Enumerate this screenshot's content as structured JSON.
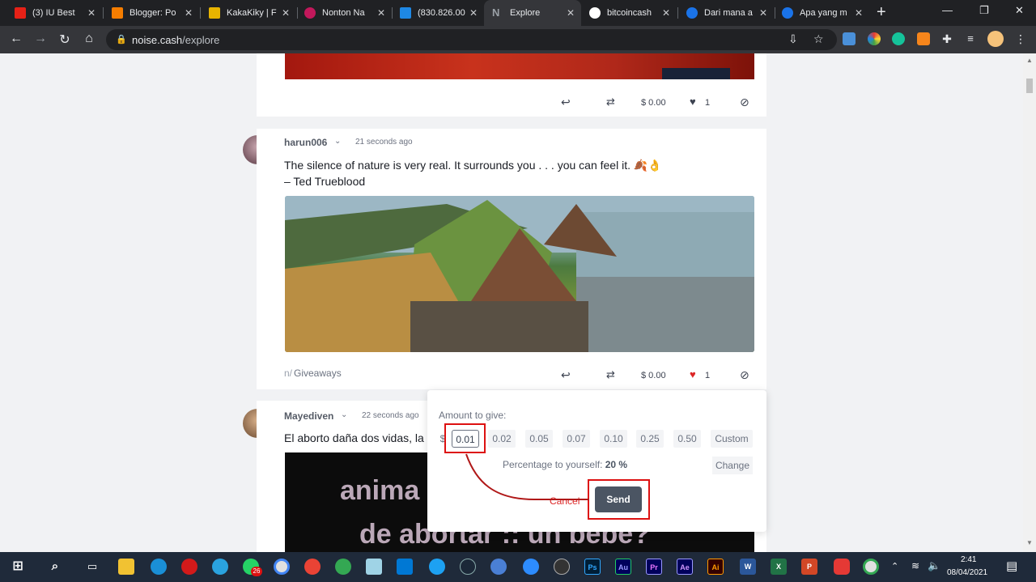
{
  "browser": {
    "tabs": [
      {
        "title": "(3) IU Best",
        "favicon_color": "#e62117"
      },
      {
        "title": "Blogger: Po",
        "favicon_color": "#f57d00"
      },
      {
        "title": "KakaKiky | F",
        "favicon_color": "#e8b400"
      },
      {
        "title": "Nonton Na",
        "favicon_color": "#c2185b"
      },
      {
        "title": "(830.826.00",
        "favicon_color": "#1e88e5"
      },
      {
        "title": "Explore",
        "favicon_color": "#9aa0a6"
      },
      {
        "title": "bitcoincash",
        "favicon_color": "#ffffff"
      },
      {
        "title": "Dari mana a",
        "favicon_color": "#1a73e8"
      },
      {
        "title": "Apa yang m",
        "favicon_color": "#1a73e8"
      }
    ],
    "url_host": "noise.cash",
    "url_path": "/explore"
  },
  "posts": [
    {
      "actions": {
        "tip": "$ 0.00",
        "likes": "1"
      }
    },
    {
      "username": "harun006",
      "time": "21 seconds ago",
      "text_line1": "The silence of nature is very real. It surrounds you . . . you can feel it. 🍂👌",
      "text_line2": "– Ted Trueblood",
      "community_prefix": "n/",
      "community": "Giveaways",
      "actions": {
        "tip": "$ 0.00",
        "likes": "1"
      }
    },
    {
      "username": "Mayediven",
      "time": "22 seconds ago",
      "text": "El aborto daña dos vidas, la",
      "image_text_line1": "anima",
      "image_text_line2": "de abortar :: un bebe?"
    }
  ],
  "tip_popup": {
    "label": "Amount to give:",
    "currency": "$",
    "amounts": [
      "0.01",
      "0.02",
      "0.05",
      "0.07",
      "0.10",
      "0.25",
      "0.50",
      "Custom"
    ],
    "selected": "0.01",
    "percentage_label": "Percentage to yourself:",
    "percentage_value": "20 %",
    "change_label": "Change",
    "cancel_label": "Cancel",
    "send_label": "Send"
  },
  "taskbar": {
    "time": "2:41",
    "date": "08/04/2021",
    "notification_badge": "26"
  }
}
